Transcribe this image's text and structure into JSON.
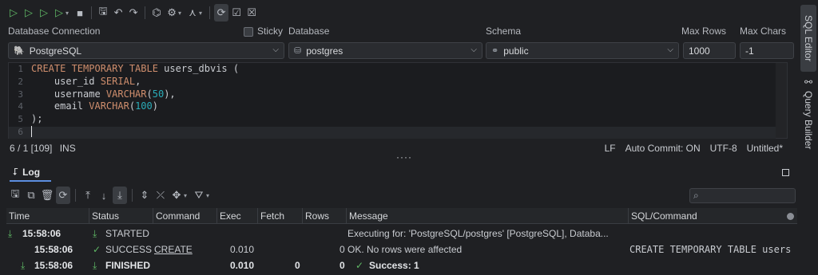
{
  "right_tabs": {
    "sql_editor": "SQL Editor",
    "query_builder": "Query Builder"
  },
  "connection": {
    "database_connection_label": "Database Connection",
    "database_connection_value": "PostgreSQL",
    "sticky_label": "Sticky",
    "database_label": "Database",
    "database_value": "postgres",
    "schema_label": "Schema",
    "schema_value": "public",
    "max_rows_label": "Max Rows",
    "max_rows_value": "1000",
    "max_chars_label": "Max Chars",
    "max_chars_value": "-1"
  },
  "editor": {
    "line_numbers": [
      "1",
      "2",
      "3",
      "4",
      "5",
      "6"
    ]
  },
  "status": {
    "position": "6 / 1 [109]",
    "mode": "INS",
    "line_ending": "LF",
    "auto_commit": "Auto Commit: ON",
    "encoding": "UTF-8",
    "file": "Untitled*"
  },
  "log": {
    "tab_label": "Log",
    "columns": [
      "Time",
      "Status",
      "Command",
      "Exec",
      "Fetch",
      "Rows",
      "Message",
      "SQL/Command"
    ],
    "rows": [
      {
        "time": "15:58:06",
        "status": "STARTED",
        "command": "",
        "exec": "",
        "fetch": "",
        "rows": "",
        "message": "Executing for: 'PostgreSQL/postgres' [PostgreSQL], Databa...",
        "sql": ""
      },
      {
        "time": "15:58:06",
        "status": "SUCCESS",
        "command": "CREATE",
        "exec": "0.010",
        "fetch": "",
        "rows": "0",
        "message": "OK. No rows were affected",
        "sql": "CREATE TEMPORARY TABLE users"
      },
      {
        "time": "15:58:06",
        "status": "FINISHED",
        "command": "",
        "exec": "0.010",
        "fetch": "0",
        "rows": "0",
        "message": "Success: 1",
        "sql": ""
      }
    ]
  },
  "colors": {
    "accent": "#5c8ee0",
    "success": "#5fb865",
    "keyword": "#cf8e6d",
    "number": "#2aacb8"
  }
}
